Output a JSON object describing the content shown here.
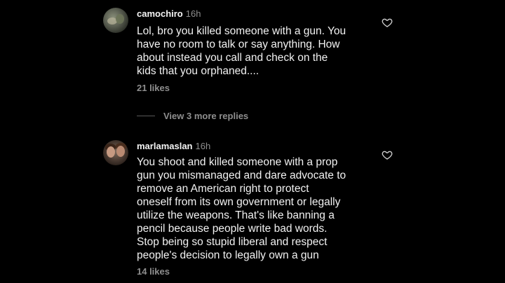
{
  "comments": [
    {
      "username": "camochiro",
      "time": "16h",
      "text": "Lol, bro you killed someone with a gun. You\nhave no room to talk or say anything. How\nabout instead you call and check on the\nkids that you orphaned....",
      "likes": "21 likes"
    },
    {
      "username": "marlamaslan",
      "time": "16h",
      "text": "You shoot and killed someone with a prop\ngun you mismanaged and dare advocate to\nremove an American right to protect\noneself from its own government or legally\nutilize the weapons.  That's like banning a\npencil because people write bad words.\nStop being so stupid liberal and respect\npeople's decision to legally own a gun",
      "likes": "14 likes"
    }
  ],
  "replies_toggle": "View 3 more replies",
  "icons": [
    "heart-icon"
  ],
  "colors": {
    "background": "#000000",
    "text": "#f2f2f2",
    "muted": "#8e8e8e"
  }
}
